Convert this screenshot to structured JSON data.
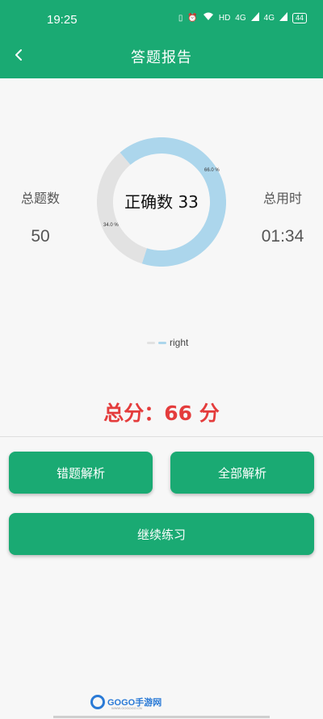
{
  "status_bar": {
    "time": "19:25",
    "network": "HD",
    "signal1": "4G",
    "signal2": "4G",
    "battery": "44"
  },
  "header": {
    "title": "答题报告"
  },
  "stats": {
    "total_questions_label": "总题数",
    "total_questions_value": "50",
    "total_time_label": "总用时",
    "total_time_value": "01:34"
  },
  "donut": {
    "center_text": "正确数 33",
    "right_pct_label": "66.0 %",
    "wrong_pct_label": "34.0 %",
    "right_fraction": 0.66,
    "wrong_fraction": 0.34,
    "right_color": "#acd6ec",
    "wrong_color": "#e2e2e2"
  },
  "legend": {
    "label": "right"
  },
  "score": {
    "text": "总分：66 分"
  },
  "buttons": {
    "wrong_analysis": "错题解析",
    "all_analysis": "全部解析",
    "continue": "继续练习"
  },
  "watermark": {
    "brand": "GOGO手游网",
    "site": "WWW.GOGOGO.CN"
  },
  "colors": {
    "primary": "#1aaa73",
    "score": "#e43c3c"
  }
}
